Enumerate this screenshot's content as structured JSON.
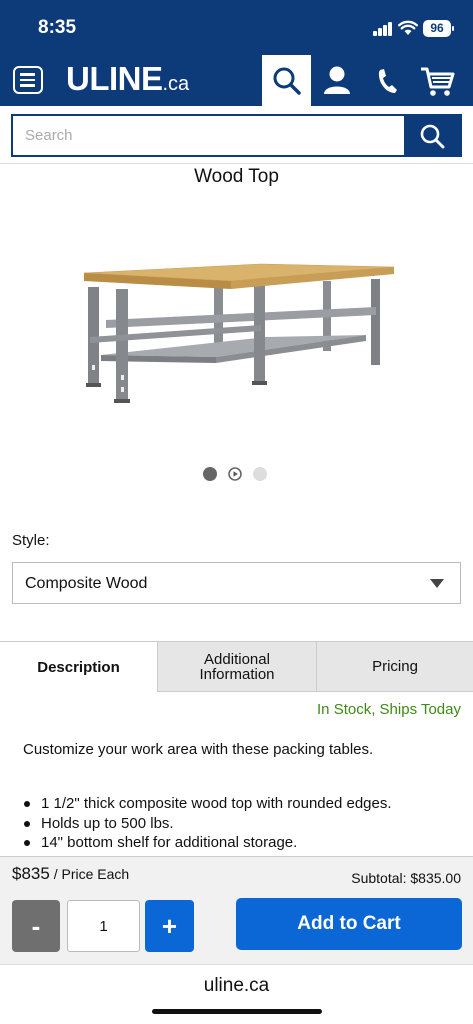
{
  "status_bar": {
    "time": "8:35",
    "battery": "96"
  },
  "header": {
    "logo": "ULINE",
    "logo_suffix": ".ca",
    "icons": [
      "menu-icon",
      "search-icon",
      "user-icon",
      "phone-icon",
      "cart-icon"
    ]
  },
  "search": {
    "placeholder": "Search"
  },
  "product": {
    "title": "Wood Top",
    "image_alt": "workbench-with-wood-top",
    "carousel": {
      "count": 3,
      "active": 0,
      "video_index": 1
    }
  },
  "style": {
    "label": "Style:",
    "selected": "Composite Wood"
  },
  "tabs": [
    {
      "label": "Description",
      "active": true
    },
    {
      "label": "Additional Information",
      "active": false
    },
    {
      "label": "Pricing",
      "active": false
    }
  ],
  "stock": {
    "text": "In Stock, Ships Today",
    "color": "#3e8a17"
  },
  "description": {
    "intro": "Customize your work area with these packing tables.",
    "bullets": [
      "1 1/2\" thick composite wood top with rounded edges.",
      "Holds up to 500 lbs.",
      "14\" bottom shelf for additional storage."
    ]
  },
  "purchase": {
    "price": "$835",
    "price_unit": " / Price Each",
    "subtotal": "Subtotal: $835.00",
    "minus_label": "-",
    "quantity": "1",
    "plus_label": "+",
    "add_to_cart": "Add to Cart"
  },
  "browser": {
    "url": "uline.ca"
  },
  "colors": {
    "brand": "#0d3a78",
    "accent": "#0c67d6",
    "stock": "#3e8a17"
  }
}
